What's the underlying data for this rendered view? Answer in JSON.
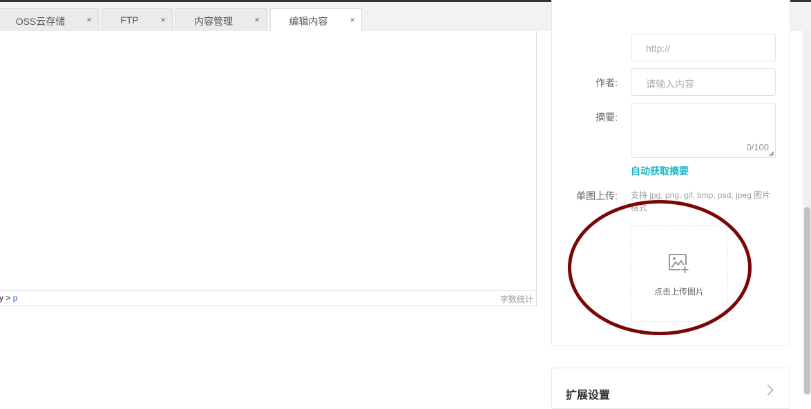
{
  "tabs": [
    {
      "label": "OSS云存储",
      "close": "×"
    },
    {
      "label": "FTP",
      "close": "×"
    },
    {
      "label": "内容管理",
      "close": "×"
    },
    {
      "label": "编辑内容",
      "close": "×",
      "active": true
    }
  ],
  "editor": {
    "path_prefix": "y > ",
    "path_current": "p",
    "word_count_label": "字数统计"
  },
  "form": {
    "url_placeholder": "http://",
    "author_label": "作者:",
    "author_placeholder": "请输入内容",
    "summary_label": "摘要:",
    "summary_counter": "0/100",
    "auto_summary_link": "自动获取摘要",
    "upload_label": "单图上传:",
    "upload_hint": "支持 jpg, png, gif, bmp, psd, jpeg 图片格式",
    "upload_button_text": "点击上传图片"
  },
  "extension_panel": {
    "title": "扩展设置"
  },
  "colors": {
    "accent": "#1ab5c8",
    "annotation": "#7a0606",
    "path_link": "#1c5fd1"
  }
}
